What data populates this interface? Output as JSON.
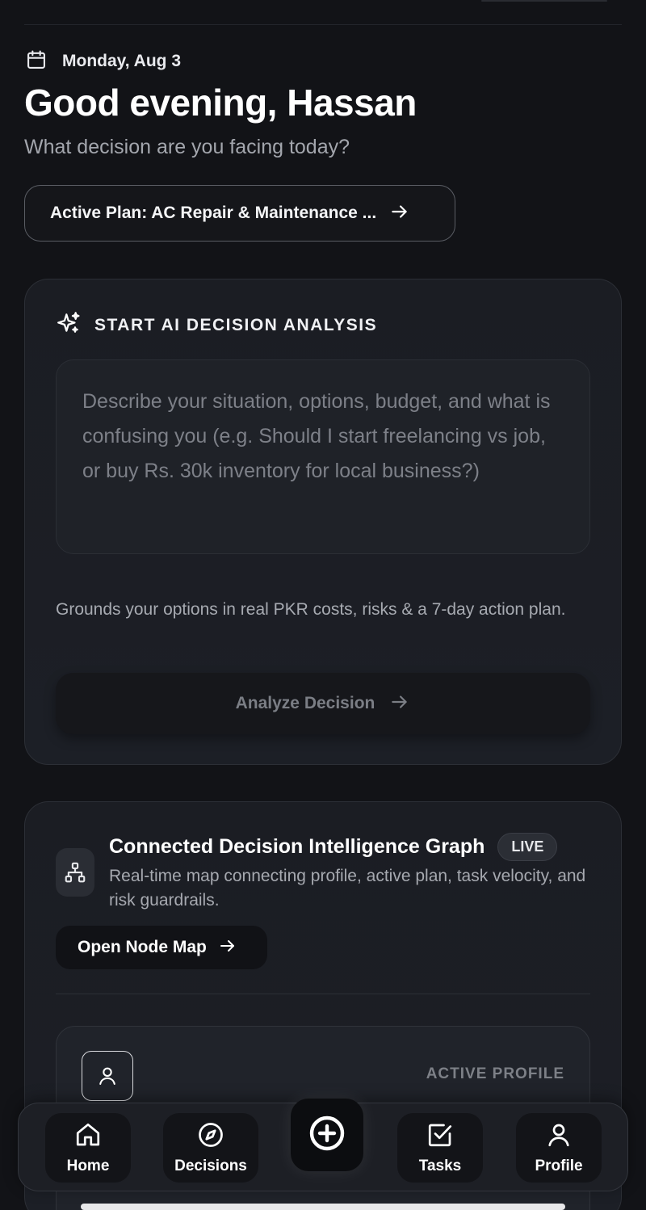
{
  "header": {
    "date": "Monday, Aug 3",
    "greeting": "Good evening, Hassan",
    "subtitle": "What decision are you facing today?",
    "active_plan_label": "Active Plan: AC Repair & Maintenance ..."
  },
  "ai_card": {
    "title": "START AI DECISION ANALYSIS",
    "input_placeholder": "Describe your situation, options, budget, and what is confusing you (e.g. Should I start freelancing vs job, or buy Rs. 30k inventory for local business?)",
    "input_value": "",
    "description": "Grounds your options in real PKR costs, risks & a 7-day action plan.",
    "analyze_label": "Analyze Decision"
  },
  "graph_card": {
    "title": "Connected Decision Intelligence Graph",
    "badge": "LIVE",
    "description": "Real-time map connecting profile, active plan, task velocity, and risk guardrails.",
    "open_label": "Open Node Map",
    "profile_label": "ACTIVE PROFILE"
  },
  "bottom_nav": {
    "items": [
      {
        "label": "Home",
        "icon": "home-icon"
      },
      {
        "label": "Decisions",
        "icon": "compass-icon"
      },
      {
        "label": "Tasks",
        "icon": "checkbox-icon"
      },
      {
        "label": "Profile",
        "icon": "user-icon"
      }
    ],
    "add_icon": "plus-circle-icon"
  },
  "colors": {
    "background": "#121317",
    "card": "#1c1f26",
    "text_primary": "#ffffff",
    "text_muted": "#a3a6ad"
  }
}
